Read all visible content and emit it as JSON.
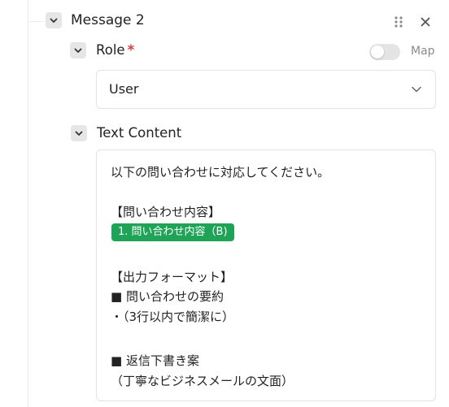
{
  "message": {
    "title": "Message 2"
  },
  "role": {
    "label": "Role",
    "required_mark": "*",
    "map_label": "Map",
    "map_enabled": false,
    "selected": "User"
  },
  "text_content": {
    "label": "Text Content",
    "lines": [
      "以下の問い合わせに対応してください。",
      "【問い合わせ内容】",
      "1. 問い合わせ内容（B)",
      "【出力フォーマット】",
      "■ 問い合わせの要約",
      "・（3行以内で簡潔に）",
      "■ 返信下書き案",
      "（丁寧なビジネスメールの文面）"
    ]
  },
  "colors": {
    "chip_bg": "#1fa356",
    "required": "#e0383e"
  },
  "icons": {
    "collapse": "chevron-down-icon",
    "drag": "drag-handle-icon",
    "close": "close-icon",
    "select_caret": "chevron-down-icon"
  }
}
